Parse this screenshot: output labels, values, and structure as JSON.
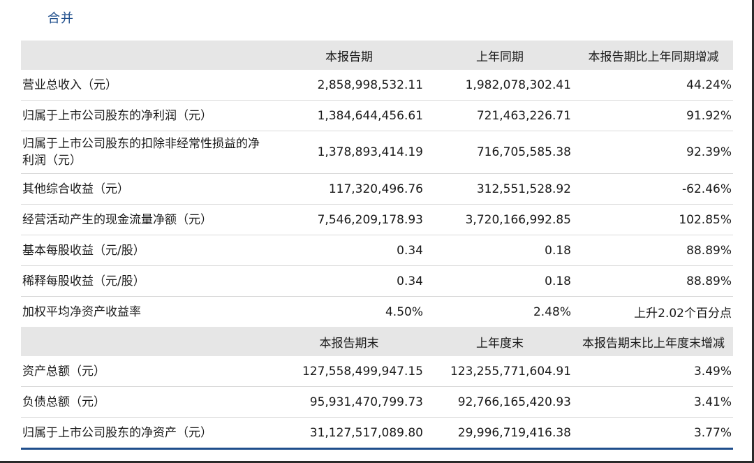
{
  "scope_label": "合并",
  "header1": [
    "",
    "本报告期",
    "上年同期",
    "本报告期比上年同期增减"
  ],
  "rows1": [
    {
      "label": "营业总收入（元）",
      "current": "2,858,998,532.11",
      "prior": "1,982,078,302.41",
      "change": "44.24%"
    },
    {
      "label": "归属于上市公司股东的净利润（元）",
      "current": "1,384,644,456.61",
      "prior": "721,463,226.71",
      "change": "91.92%"
    },
    {
      "label": "归属于上市公司股东的扣除非经常性损益的净利润（元）",
      "current": "1,378,893,414.19",
      "prior": "716,705,585.38",
      "change": "92.39%"
    },
    {
      "label": "其他综合收益（元）",
      "current": "117,320,496.76",
      "prior": "312,551,528.92",
      "change": "-62.46%"
    },
    {
      "label": "经营活动产生的现金流量净额（元）",
      "current": "7,546,209,178.93",
      "prior": "3,720,166,992.85",
      "change": "102.85%"
    },
    {
      "label": "基本每股收益（元/股）",
      "current": "0.34",
      "prior": "0.18",
      "change": "88.89%"
    },
    {
      "label": "稀释每股收益（元/股）",
      "current": "0.34",
      "prior": "0.18",
      "change": "88.89%"
    },
    {
      "label": "加权平均净资产收益率",
      "current": "4.50%",
      "prior": "2.48%",
      "change": "上升2.02个百分点"
    }
  ],
  "header2": [
    "",
    "本报告期末",
    "上年度末",
    "本报告期末比上年度末增减"
  ],
  "rows2": [
    {
      "label": "资产总额（元）",
      "current": "127,558,499,947.15",
      "prior": "123,255,771,604.91",
      "change": "3.49%"
    },
    {
      "label": "负债总额（元）",
      "current": "95,931,470,799.73",
      "prior": "92,766,165,420.93",
      "change": "3.41%"
    },
    {
      "label": "归属于上市公司股东的净资产（元）",
      "current": "31,127,517,089.80",
      "prior": "29,996,719,416.38",
      "change": "3.77%"
    }
  ],
  "colors": {
    "accent": "#1f4e8c",
    "header_bg": "#e6e6e6",
    "rule": "#d9d9d9"
  }
}
